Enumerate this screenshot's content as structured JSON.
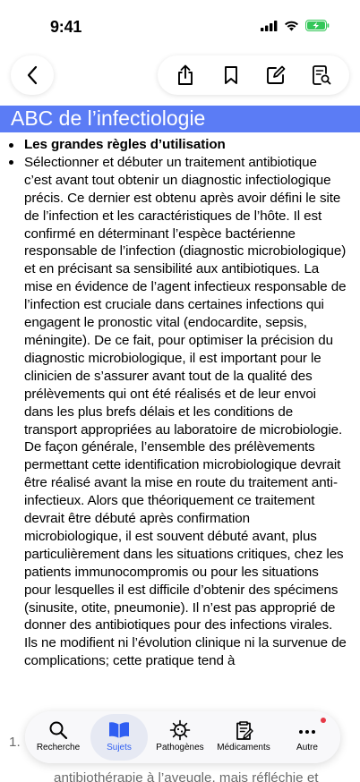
{
  "status": {
    "time": "9:41",
    "battery_color": "#34c759"
  },
  "toolbar": {
    "back_icon": "chevron-left-icon",
    "actions": [
      "share-icon",
      "bookmark-icon",
      "edit-icon",
      "document-search-icon"
    ]
  },
  "article": {
    "title": "ABC de l’infectiologie",
    "title_bg": "#5b7cf5",
    "rule_heading": "Les grandes règles d’utilisation",
    "paragraph": "Sélectionner et débuter un traitement antibiotique c’est avant tout obtenir un diagnostic infectiologique précis. Ce dernier est obtenu après avoir défini le site de l’infection et les caractéristiques de l’hôte. Il est confirmé en déterminant l’espèce bactérienne responsable de l’infection (diagnostic microbiologique) et en précisant sa sensibilité aux antibiotiques. La mise en évidence de l’agent infectieux responsable de l’infection est cruciale dans certaines infections qui engagent le pronostic vital (endocardite, sepsis, méningite). De ce fait, pour optimiser la précision du diagnostic microbiologique, il est important pour le clinicien de s’assurer avant tout de la qualité des prélèvements qui ont été réalisés et de leur envoi dans les plus brefs délais et les conditions de transport appropriées au laboratoire de microbiologie. De façon générale, l’ensemble des prélèvements permettant cette identification microbiologique devrait être réalisé avant la mise en route du traitement anti-infectieux. Alors que théoriquement ce traitement devrait être débuté après confirmation microbiologique, il est souvent débuté avant, plus particulièrement dans les situations critiques, chez les patients immunocompromis ou pour les situations pour lesquelles il est difficile d’obtenir des spécimens (sinusite, otite, pneumonie). Il n’est pas approprié de donner des antibiotiques pour des infections virales. Ils ne modifient ni l’évolution clinique ni la survenue de complications; cette pratique tend à",
    "numbered_label": "1.",
    "numbered_line": "antibiothérapie à l’aveugle, mais réfléchie et"
  },
  "tabs": [
    {
      "label": "Recherche",
      "icon": "search-icon",
      "active": false
    },
    {
      "label": "Sujets",
      "icon": "book-open-icon",
      "active": true
    },
    {
      "label": "Pathogènes",
      "icon": "virus-icon",
      "active": false
    },
    {
      "label": "Médicaments",
      "icon": "prescription-icon",
      "active": false
    },
    {
      "label": "Autre",
      "icon": "more-icon",
      "active": false,
      "badge": true
    }
  ],
  "colors": {
    "accent": "#2f5ef2",
    "badge": "#e63946"
  }
}
